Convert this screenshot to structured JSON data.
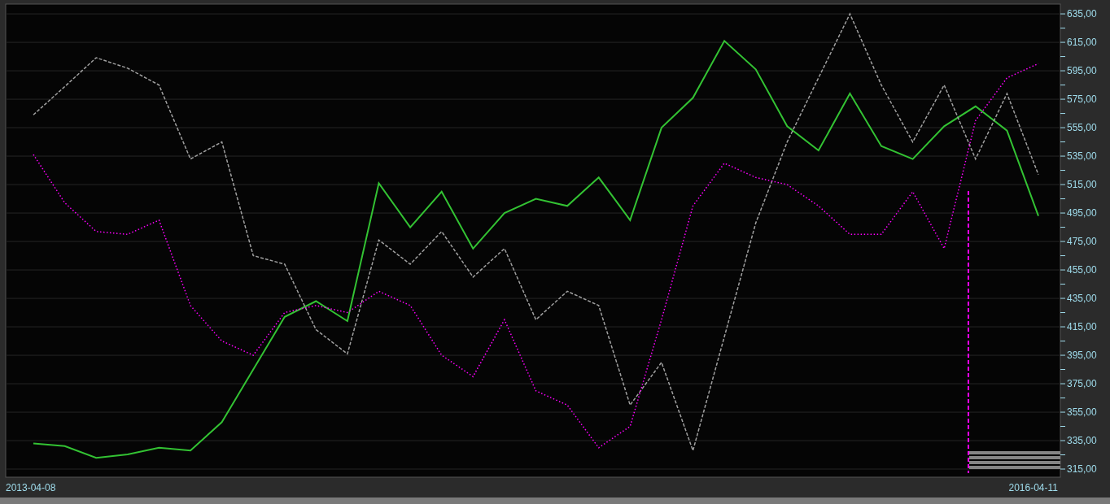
{
  "chart": {
    "chart_data": {
      "type": "line",
      "categories": [
        "2013-04-08",
        null,
        null,
        null,
        null,
        null,
        null,
        null,
        null,
        null,
        null,
        null,
        null,
        null,
        null,
        null,
        null,
        null,
        null,
        null,
        null,
        null,
        null,
        null,
        null,
        null,
        null,
        null,
        null,
        null,
        null,
        null,
        "2016-04-11"
      ],
      "ylim": [
        309.3,
        641.9
      ],
      "grid": true,
      "yticks": [
        {
          "value": 315,
          "label": "315,00"
        },
        {
          "value": 335,
          "label": "335,00"
        },
        {
          "value": 355,
          "label": "355,00"
        },
        {
          "value": 375,
          "label": "375,00"
        },
        {
          "value": 395,
          "label": "395,00"
        },
        {
          "value": 415,
          "label": "415,00"
        },
        {
          "value": 435,
          "label": "435,00"
        },
        {
          "value": 455,
          "label": "455,00"
        },
        {
          "value": 475,
          "label": "475,00"
        },
        {
          "value": 495,
          "label": "495,00"
        },
        {
          "value": 515,
          "label": "515,00"
        },
        {
          "value": 535,
          "label": "535,00"
        },
        {
          "value": 555,
          "label": "555,00"
        },
        {
          "value": 575,
          "label": "575,00"
        },
        {
          "value": 595,
          "label": "595,00"
        },
        {
          "value": 615,
          "label": "615,00"
        },
        {
          "value": 635,
          "label": "635,00"
        }
      ],
      "series": [
        {
          "color": "#33c233",
          "line_style": "solid",
          "values": [
            333,
            331.2,
            322.9,
            325.3,
            330,
            328,
            348,
            385,
            422,
            433,
            419,
            516,
            485,
            510,
            470,
            495,
            505,
            500,
            520,
            490,
            555,
            576,
            616,
            596,
            556,
            539,
            579,
            542,
            533,
            556,
            570,
            553,
            493
          ]
        },
        {
          "color": "#a0a0a0",
          "line_style": "dashed",
          "values": [
            564,
            583.9,
            604.2,
            596.8,
            585,
            533,
            545,
            465,
            459,
            413,
            396,
            476,
            459,
            482,
            450,
            470,
            420,
            440,
            430,
            360,
            390,
            328,
            408,
            488,
            545,
            590,
            635,
            585,
            545,
            585,
            533,
            579,
            522
          ]
        },
        {
          "color": "#ff00ff",
          "line_style": "dotted",
          "values": [
            536.1,
            502.2,
            482,
            480,
            490,
            430,
            405,
            395,
            425,
            430,
            425,
            440,
            430,
            395,
            380,
            420,
            370,
            360,
            330,
            345,
            420,
            500,
            530,
            520,
            515,
            500,
            480,
            480,
            510,
            470,
            560,
            590,
            600
          ]
        }
      ]
    }
  }
}
